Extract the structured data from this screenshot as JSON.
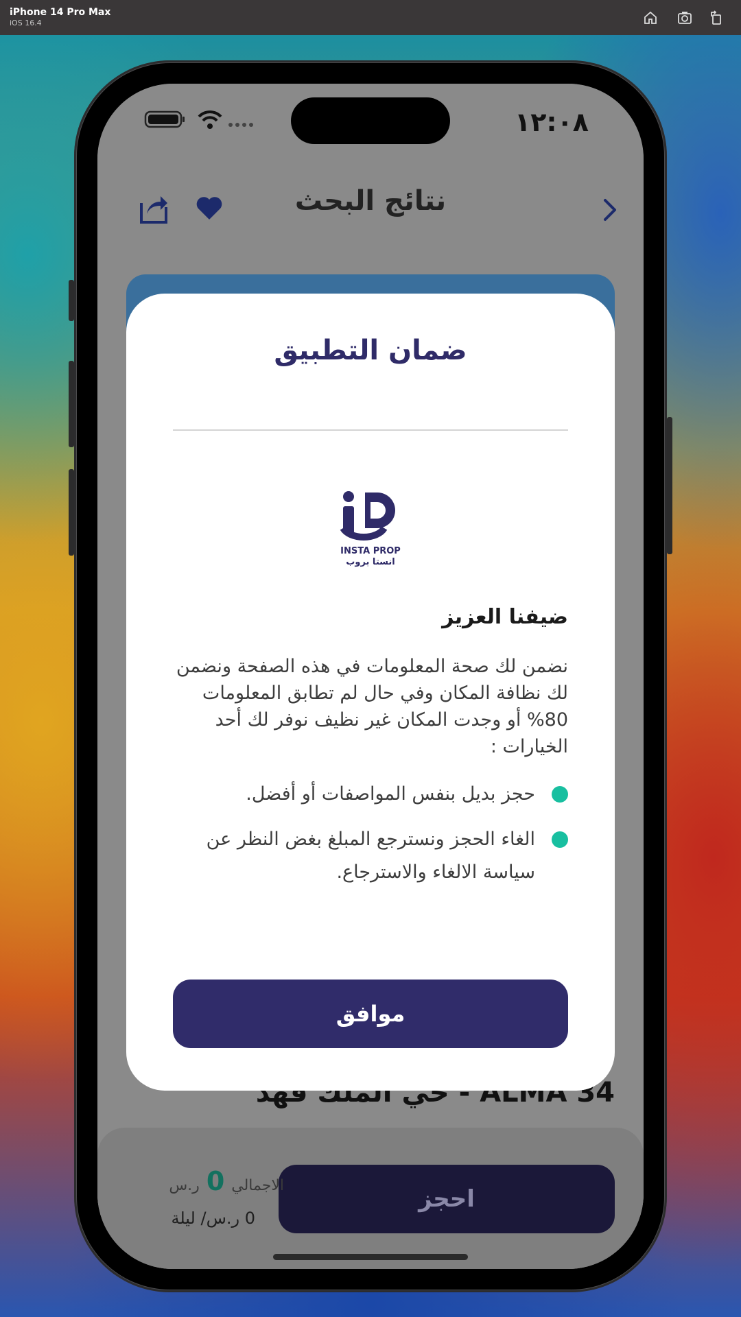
{
  "simulator": {
    "device_name": "iPhone 14 Pro Max",
    "os_version": "iOS 16.4",
    "buttons": [
      "home-icon",
      "screenshot-icon",
      "rotate-icon"
    ]
  },
  "status_bar": {
    "time": "١٢:٠٨",
    "icons": [
      "battery-icon",
      "wifi-icon",
      "signal-icon"
    ]
  },
  "header": {
    "title": "نتائج البحث",
    "icons": [
      "chevron-right-icon",
      "heart-icon",
      "share-icon"
    ]
  },
  "listing": {
    "title": "ALMA 34 - حي الملك فهد"
  },
  "bottom_bar": {
    "book_label": "احجز",
    "total_label": "الاجمالي",
    "total_value": "0",
    "total_currency": "ر.س",
    "per_night": "0 ر.س/ ليلة"
  },
  "modal": {
    "title": "ضمان التطبيق",
    "logo_text_en": "INSTA PROP",
    "logo_text_ar": "انستا بروب",
    "greeting": "ضيفنا العزيز",
    "body": "نضمن لك صحة المعلومات في هذه الصفحة ونضمن لك نظافة المكان وفي حال لم تطابق المعلومات 80% أو وجدت المكان غير نظيف نوفر لك أحد الخيارات :",
    "options": [
      "حجز بديل بنفس المواصفات أو أفضل.",
      "الغاء الحجز ونسترجع المبلغ بغض النظر عن سياسة الالغاء والاسترجاع."
    ],
    "ok_label": "موافق",
    "accent_color": "#302c6a",
    "bullet_color": "#18bfa0"
  }
}
